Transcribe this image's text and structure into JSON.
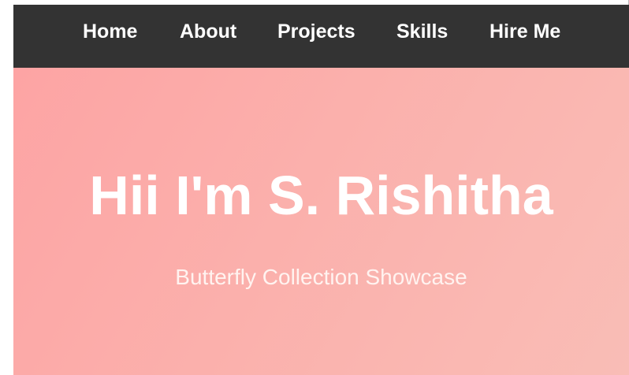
{
  "nav": {
    "items": [
      {
        "label": "Home"
      },
      {
        "label": "About"
      },
      {
        "label": "Projects"
      },
      {
        "label": "Skills"
      },
      {
        "label": "Hire Me"
      }
    ]
  },
  "hero": {
    "title": "Hii I'm S. Rishitha",
    "subtitle": "Butterfly Collection Showcase"
  },
  "colors": {
    "navbar_bg": "#333333",
    "nav_text": "#ffffff",
    "hero_gradient_start": "#fda4a4",
    "hero_gradient_end": "#f9bdb6",
    "hero_text": "#ffffff"
  }
}
